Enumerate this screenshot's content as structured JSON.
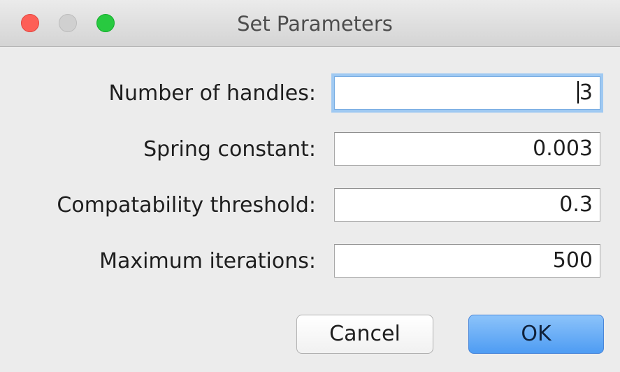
{
  "window": {
    "title": "Set Parameters",
    "controls": [
      "close",
      "minimize",
      "zoom"
    ]
  },
  "form": {
    "fields": [
      {
        "label": "Number of handles:",
        "value": "3",
        "focused": true
      },
      {
        "label": "Spring constant:",
        "value": "0.003",
        "focused": false
      },
      {
        "label": "Compatability threshold:",
        "value": "0.3",
        "focused": false
      },
      {
        "label": "Maximum iterations:",
        "value": "500",
        "focused": false
      }
    ]
  },
  "buttons": {
    "cancel_label": "Cancel",
    "ok_label": "OK"
  },
  "colors": {
    "close": "#fd5f57",
    "minimize": "#d0d0d0",
    "zoom": "#28c940",
    "focus_ring": "#9fc9f2",
    "default_button": "#4e9cf3"
  }
}
